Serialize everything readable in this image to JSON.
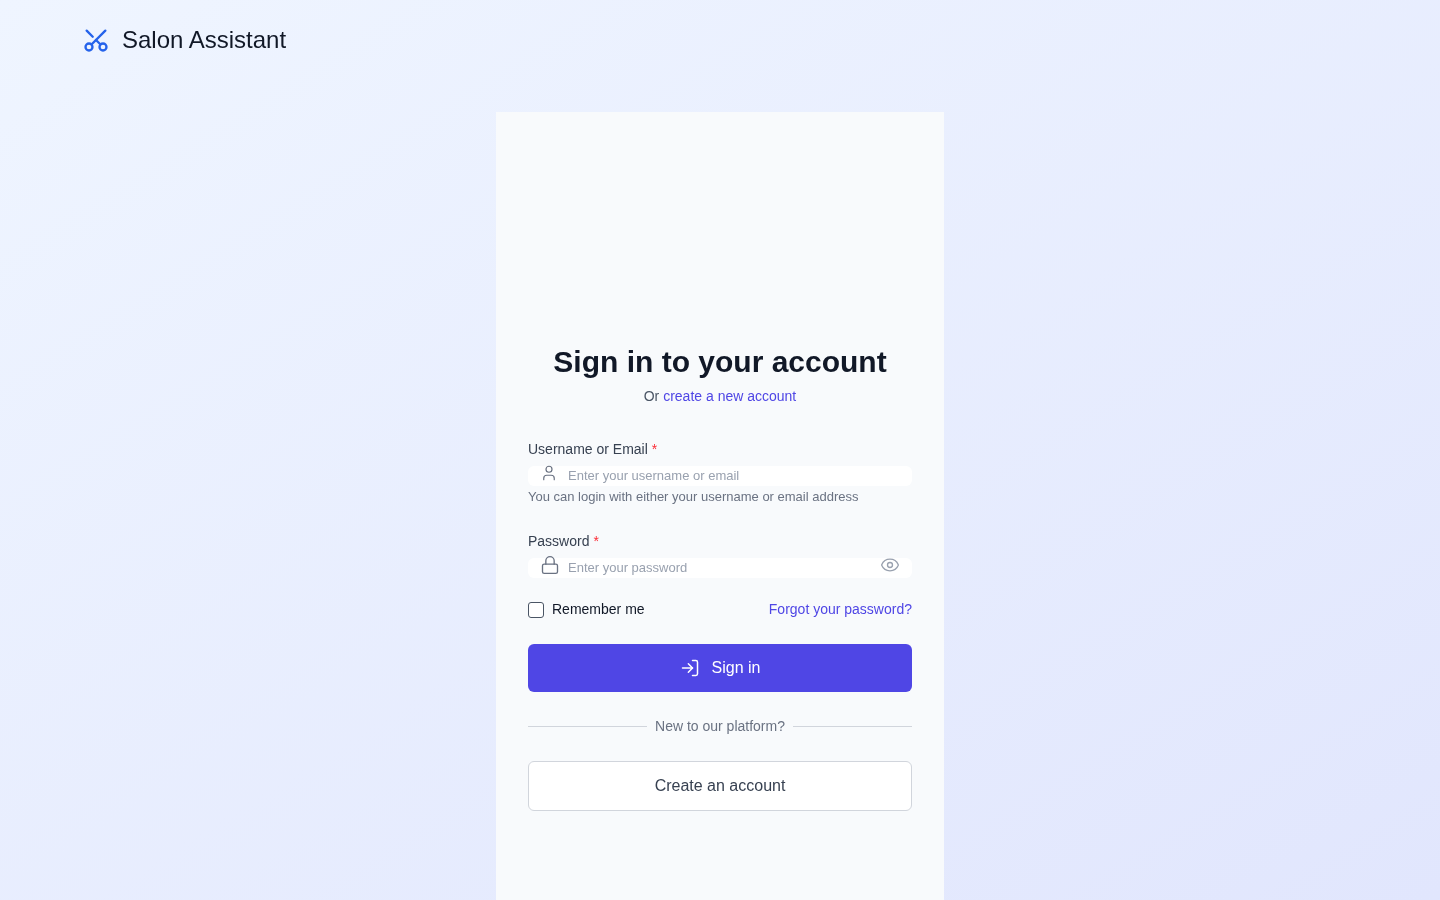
{
  "brand": {
    "name": "Salon Assistant"
  },
  "heading": {
    "title": "Sign in to your account",
    "subtitle_prefix": "Or",
    "subtitle_link": "create a new account"
  },
  "fields": [
    {
      "kind": "username",
      "label": "Username or Email",
      "required": "*",
      "placeholder": "Enter your username or email",
      "help": "You can login with either your username or email address",
      "reveal_toggle": false
    },
    {
      "kind": "password",
      "label": "Password",
      "required": "*",
      "placeholder": "Enter your password",
      "reveal_toggle": true
    }
  ],
  "remember": {
    "label": "Remember me",
    "checked": false
  },
  "forgot_link": "Forgot your password?",
  "submit": {
    "label": "Sign in"
  },
  "divider": "New to our platform?",
  "create_button": "Create an account"
}
